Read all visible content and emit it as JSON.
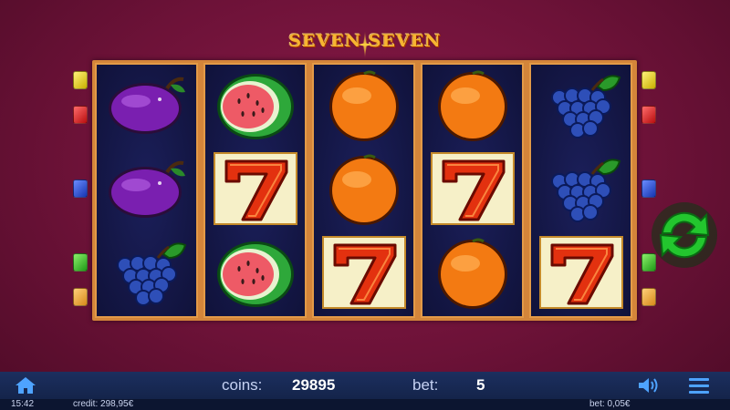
{
  "game": {
    "logo_text": "SEVEN SEVEN"
  },
  "reels": [
    {
      "symbols": [
        "plum",
        "plum",
        "grapes"
      ]
    },
    {
      "symbols": [
        "watermelon",
        "seven",
        "watermelon"
      ]
    },
    {
      "symbols": [
        "orange",
        "orange",
        "seven"
      ]
    },
    {
      "symbols": [
        "orange",
        "seven",
        "orange"
      ]
    },
    {
      "symbols": [
        "grapes",
        "grapes",
        "seven"
      ]
    }
  ],
  "paylines": {
    "left": [
      "yellow",
      "red",
      "blue",
      "green",
      "orange"
    ],
    "right": [
      "yellow",
      "red",
      "blue",
      "green",
      "orange"
    ]
  },
  "controls": {
    "spin_icon": "refresh-icon",
    "home_icon": "home-icon",
    "sound_icon": "speaker-icon",
    "menu_icon": "hamburger-icon"
  },
  "bottom_bar": {
    "coins_label": "coins:",
    "coins_value": "29895",
    "bet_label": "bet:",
    "bet_value": "5"
  },
  "status_bar": {
    "time": "15:42",
    "credit": "credit: 298,95€",
    "bet": "bet: 0,05€"
  },
  "colors": {
    "background": "#6d1238",
    "reel_frame": "#d4853a",
    "reel_bg": "#10123a",
    "spin_button": "#21c12b",
    "bar_bg": "#1c2f5f"
  }
}
